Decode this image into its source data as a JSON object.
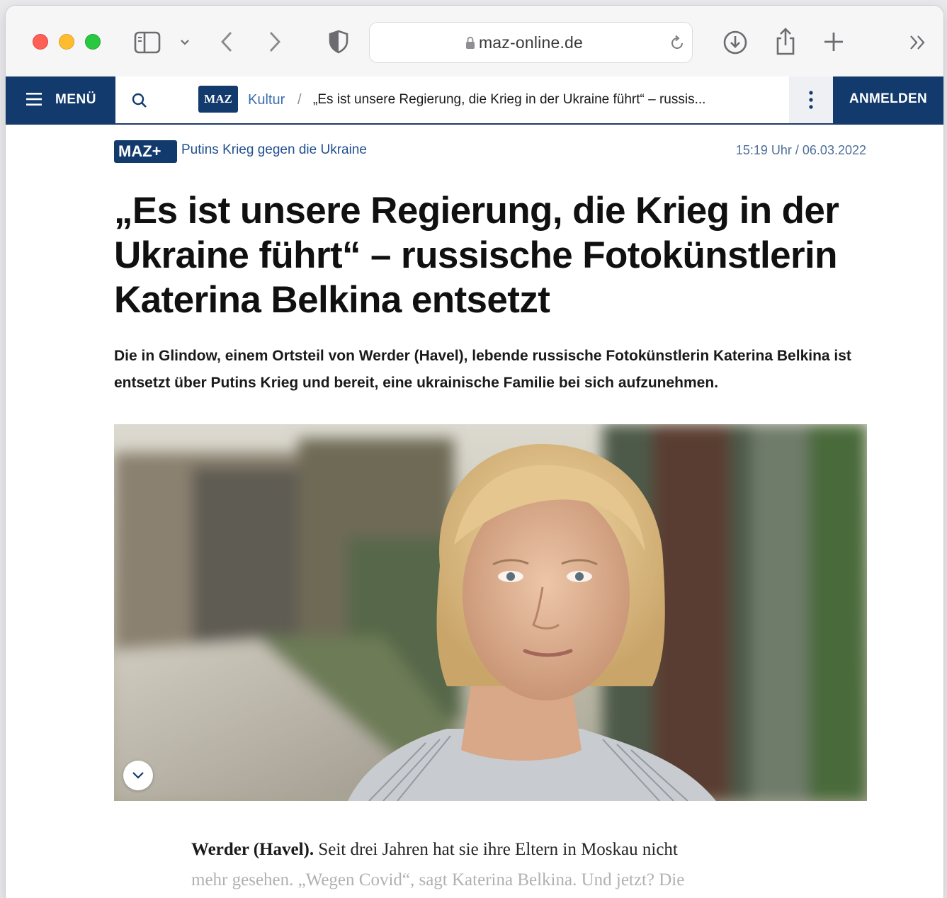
{
  "browser": {
    "url": "maz-online.de",
    "icons": [
      "sidebar-icon",
      "chevron-down-icon",
      "back-icon",
      "forward-icon",
      "shield-icon",
      "lock-icon",
      "reload-icon",
      "download-icon",
      "share-icon",
      "new-tab-icon",
      "more-chevron-icon"
    ]
  },
  "nav": {
    "menu_label": "MENÜ",
    "logo_text": "MAZ",
    "breadcrumb_section": "Kultur",
    "breadcrumb_separator": "/",
    "breadcrumb_title": "„Es ist unsere Regierung, die Krieg in der Ukraine führt“ – russis...",
    "login_label": "ANMELDEN",
    "brand_color": "#123a6d"
  },
  "article": {
    "badge": "MAZ+",
    "kicker": "Putins Krieg gegen die Ukraine",
    "date": "15:19 Uhr / 06.03.2022",
    "headline": "„Es ist unsere Regierung, die Krieg in der Ukraine führt“ – russische Fotokünstlerin Katerina Belkina entsetzt",
    "teaser": "Die in Glindow, einem Ortsteil von Werder (Havel), lebende russische Fotokünstlerin Katerina Belkina ist entsetzt über Putins Krieg und bereit, eine ukrainische Familie bei sich aufzunehmen.",
    "body_lead": "Werder (Havel).",
    "body_line1": "Seit drei Jahren hat sie ihre Eltern in Moskau nicht",
    "body_line2": "mehr gesehen. „Wegen Covid“, sagt Katerina Belkina. Und jetzt? Die"
  }
}
